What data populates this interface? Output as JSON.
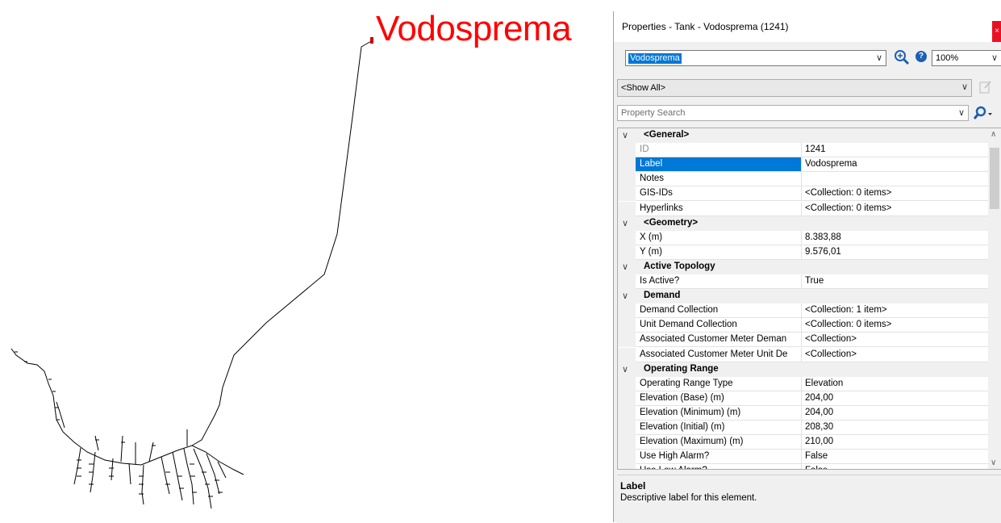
{
  "canvas": {
    "tank_label": "Vodosprema",
    "label_color": "#ff0000"
  },
  "panel": {
    "title": "Properties - Tank - Vodosprema (1241)",
    "close_label": "×",
    "element_combo_value": "Vodosprema",
    "zoom_value": "100%",
    "filter_value": "<Show All>",
    "search_placeholder": "Property Search",
    "help_glyph": "?",
    "icons": [
      "zoom-to-icon",
      "help-icon",
      "edit-icon",
      "search-icon",
      "close-icon"
    ]
  },
  "grid": {
    "rows": [
      {
        "kind": "cat",
        "name": "<General>"
      },
      {
        "kind": "prop",
        "name": "ID",
        "value": "1241",
        "state": "disabled"
      },
      {
        "kind": "prop",
        "name": "Label",
        "value": "Vodosprema",
        "state": "selected"
      },
      {
        "kind": "prop",
        "name": "Notes",
        "value": ""
      },
      {
        "kind": "prop",
        "name": "GIS-IDs",
        "value": "<Collection: 0 items>"
      },
      {
        "kind": "prop",
        "name": "Hyperlinks",
        "value": "<Collection: 0 items>"
      },
      {
        "kind": "cat",
        "name": "<Geometry>"
      },
      {
        "kind": "prop",
        "name": "X (m)",
        "value": "8.383,88"
      },
      {
        "kind": "prop",
        "name": "Y (m)",
        "value": "9.576,01"
      },
      {
        "kind": "cat",
        "name": "Active Topology"
      },
      {
        "kind": "prop",
        "name": "Is Active?",
        "value": "True"
      },
      {
        "kind": "cat",
        "name": "Demand"
      },
      {
        "kind": "prop",
        "name": "Demand Collection",
        "value": "<Collection: 1 item>"
      },
      {
        "kind": "prop",
        "name": "Unit Demand Collection",
        "value": "<Collection: 0 items>"
      },
      {
        "kind": "prop",
        "name": "Associated Customer Meter Deman",
        "value": "<Collection>"
      },
      {
        "kind": "prop",
        "name": "Associated Customer Meter Unit De",
        "value": "<Collection>"
      },
      {
        "kind": "cat",
        "name": "Operating Range"
      },
      {
        "kind": "prop",
        "name": "Operating Range Type",
        "value": "Elevation"
      },
      {
        "kind": "prop",
        "name": "Elevation (Base) (m)",
        "value": "204,00"
      },
      {
        "kind": "prop",
        "name": "Elevation (Minimum) (m)",
        "value": "204,00"
      },
      {
        "kind": "prop",
        "name": "Elevation (Initial) (m)",
        "value": "208,30"
      },
      {
        "kind": "prop",
        "name": "Elevation (Maximum) (m)",
        "value": "210,00"
      },
      {
        "kind": "prop",
        "name": "Use High Alarm?",
        "value": "False"
      },
      {
        "kind": "prop",
        "name": "Use Low Alarm?",
        "value": "False"
      }
    ]
  },
  "description": {
    "title": "Label",
    "text": "Descriptive label for this element."
  }
}
